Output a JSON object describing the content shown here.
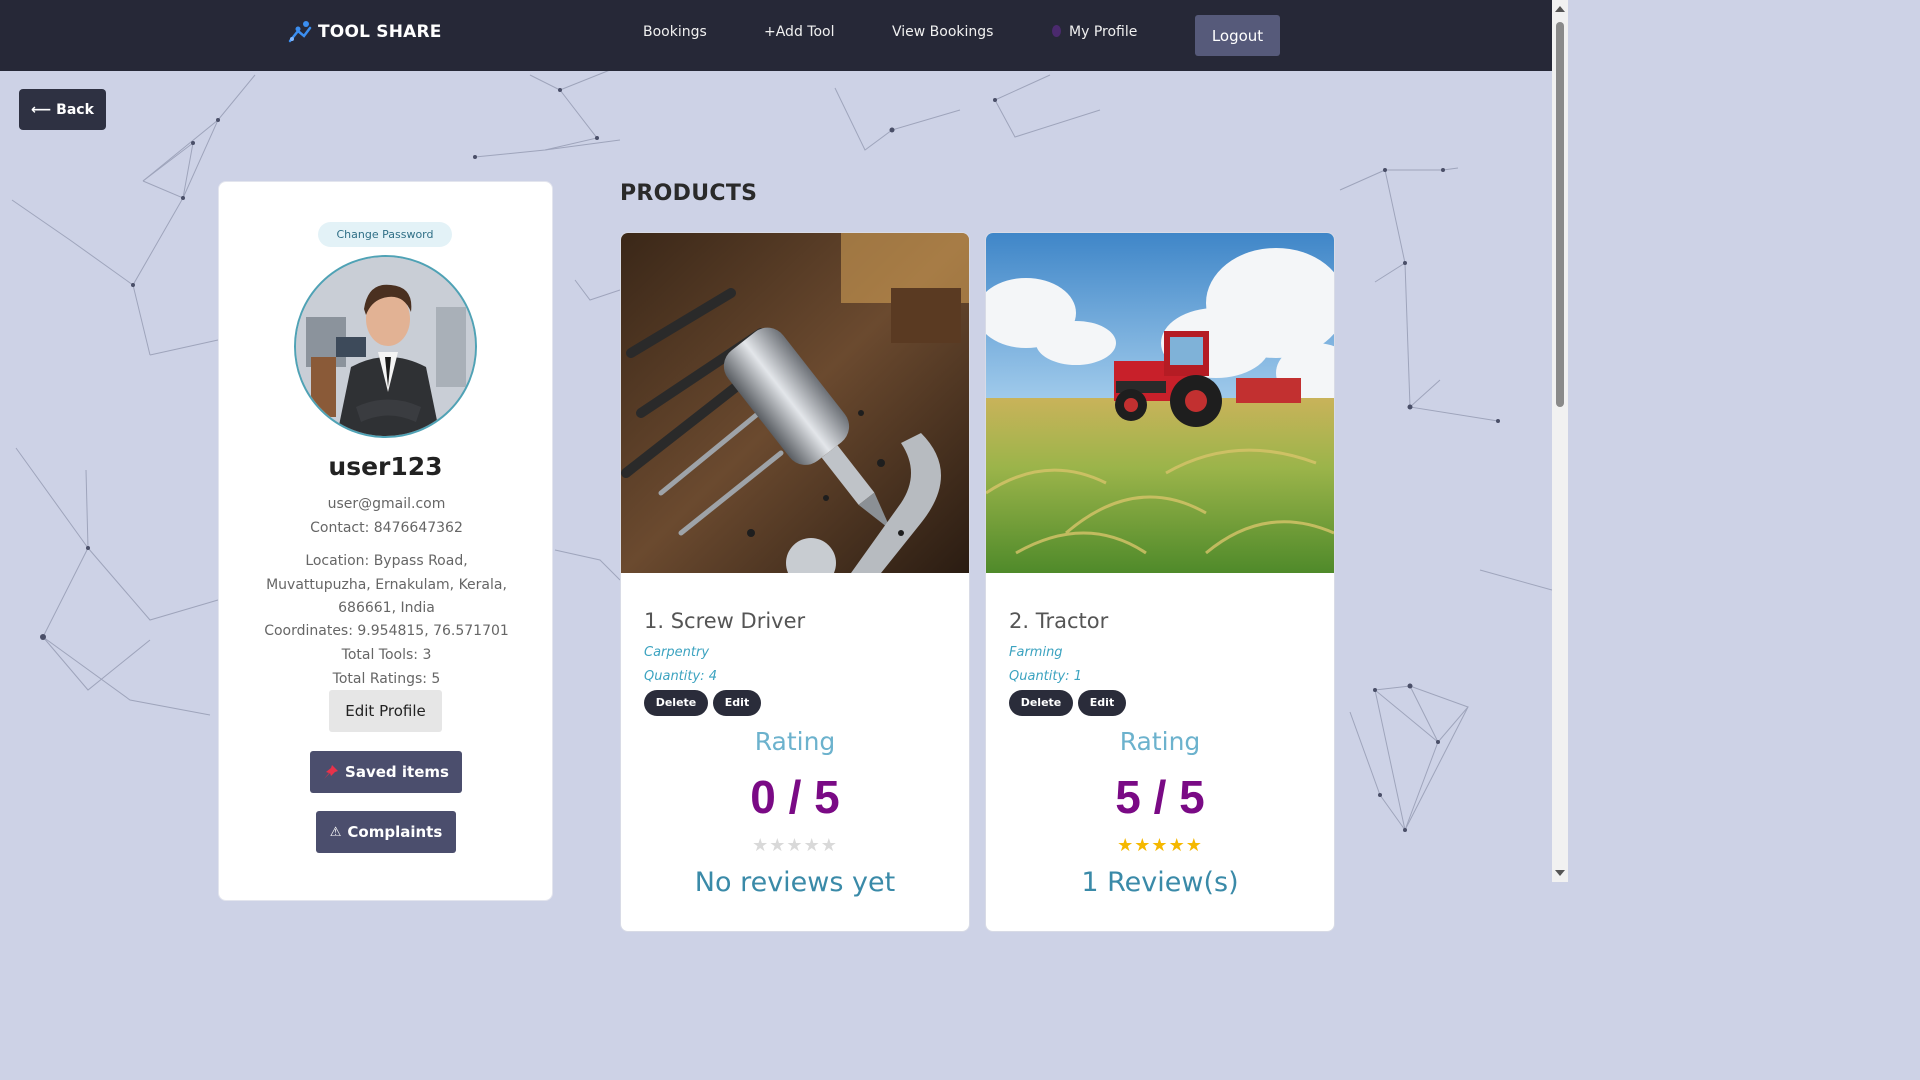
{
  "nav": {
    "brand": "TOOL SHARE",
    "links": {
      "bookings": "Bookings",
      "add_tool": "+Add Tool",
      "view_bookings": "View Bookings",
      "my_profile": "My Profile"
    },
    "logout": "Logout"
  },
  "back": {
    "label": "Back"
  },
  "profile": {
    "change_password": "Change Password",
    "username": "user123",
    "email": "user@gmail.com",
    "contact": "Contact: 8476647362",
    "location_lines": [
      "Location: Bypass Road,",
      "Muvattupuzha, Ernakulam, Kerala,",
      "686661, India"
    ],
    "coordinates": "Coordinates: 9.954815, 76.571701",
    "total_tools": "Total Tools: 3",
    "total_ratings": "Total Ratings: 5",
    "edit_profile": "Edit Profile",
    "saved_items": "Saved items",
    "complaints": "Complaints"
  },
  "products": {
    "title": "PRODUCTS",
    "items": [
      {
        "name": "1. Screw Driver",
        "category": "Carpentry",
        "quantity": "Quantity: 4",
        "delete": "Delete",
        "edit": "Edit",
        "rating_label": "Rating",
        "rating_value": "0 / 5",
        "stars_filled": 0,
        "stars_total": 5,
        "review_text": "No reviews yet"
      },
      {
        "name": "2. Tractor",
        "category": "Farming",
        "quantity": "Quantity: 1",
        "delete": "Delete",
        "edit": "Edit",
        "rating_label": "Rating",
        "rating_value": "5 / 5",
        "stars_filled": 5,
        "stars_total": 5,
        "review_text": "1 Review(s)"
      }
    ]
  },
  "colors": {
    "navbar": "#262837",
    "background": "#cdd2e6",
    "accent_teal": "#3ca3c0",
    "rating_purple": "#7a0a85",
    "star_gold": "#f5b800",
    "star_empty": "#d9d9d9"
  },
  "icons": {
    "brand": "tool-share-logo-icon",
    "back": "arrow-left-icon",
    "profile": "user-pin-icon",
    "saved": "pushpin-icon",
    "complaints": "warning-icon"
  }
}
